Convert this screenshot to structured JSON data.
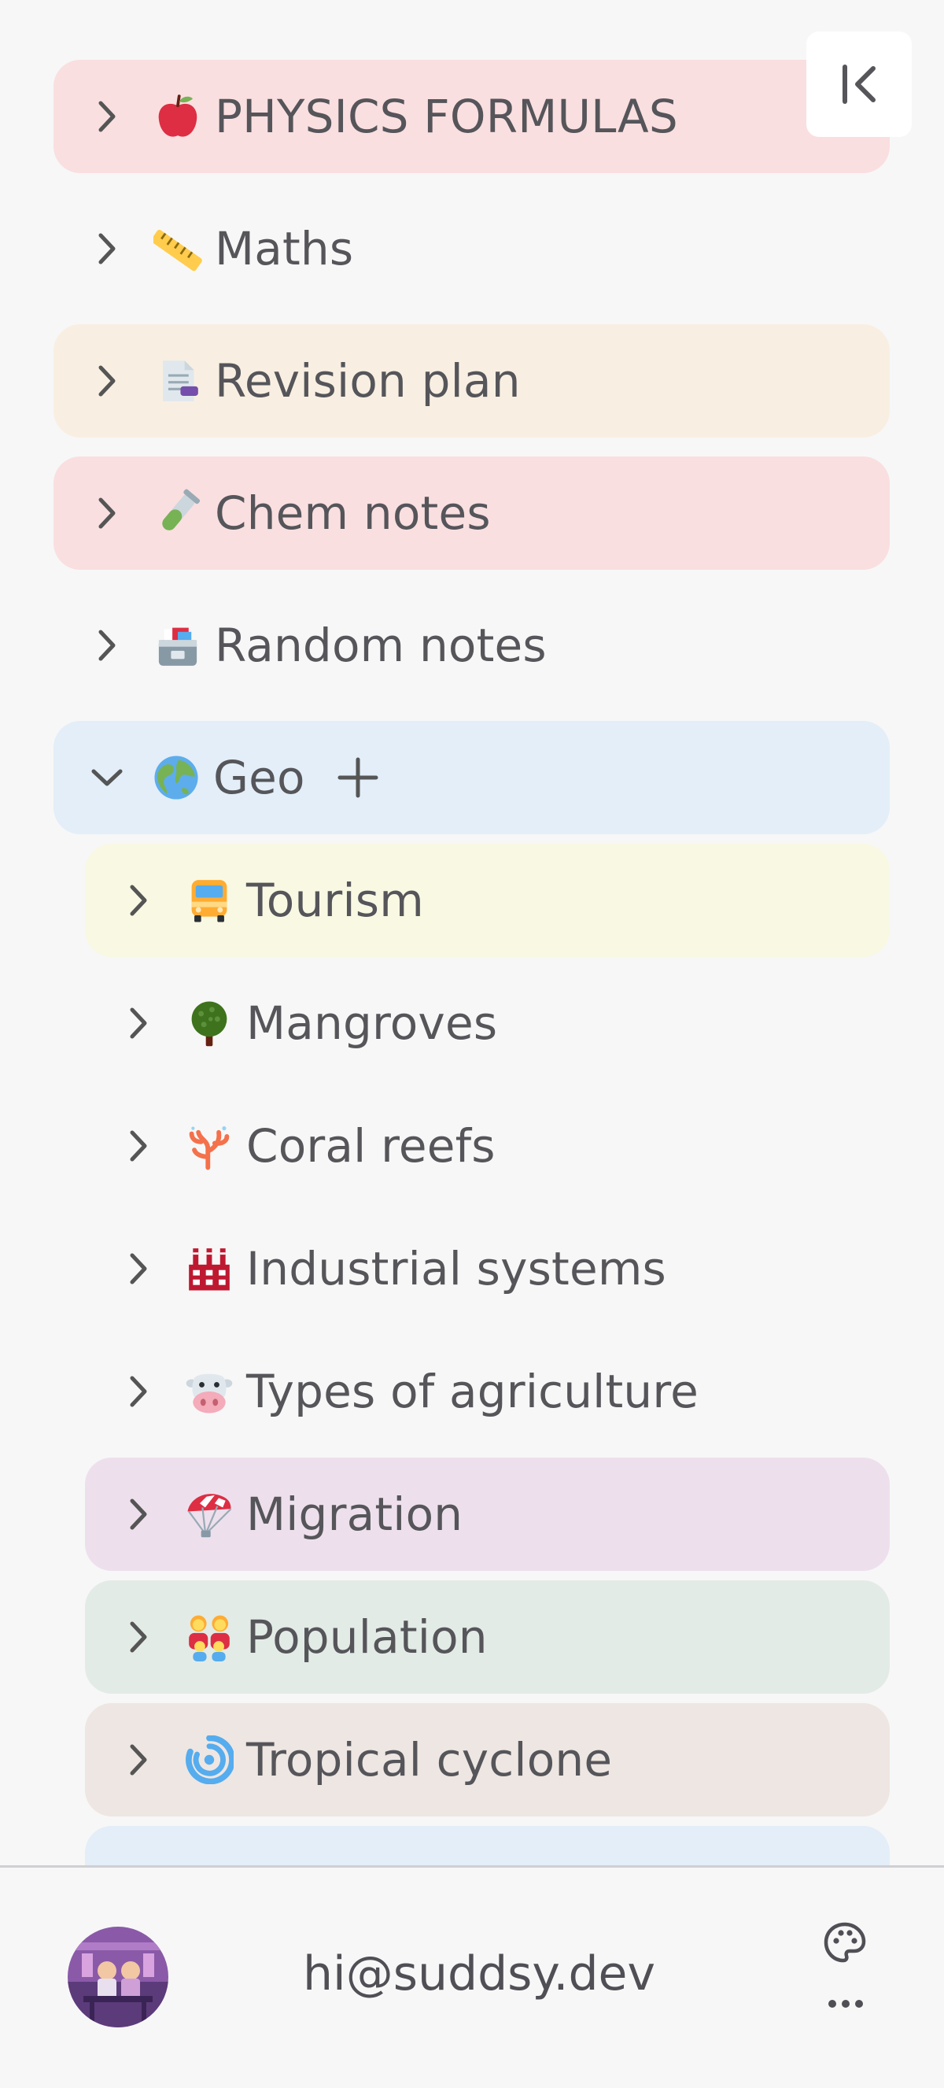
{
  "sidebar": {
    "items": [
      {
        "label": "PHYSICS FORMULAS",
        "icon": "red-apple-icon",
        "background": "#fadfe0"
      },
      {
        "label": "Maths",
        "icon": "ruler-icon",
        "background": "transparent"
      },
      {
        "label": "Revision plan",
        "icon": "document-icon",
        "background": "#f8efe2"
      },
      {
        "label": "Chem notes",
        "icon": "test-tube-icon",
        "background": "#fadfe0"
      },
      {
        "label": "Random notes",
        "icon": "card-file-box-icon",
        "background": "transparent"
      },
      {
        "label": "Geo",
        "icon": "globe-icon",
        "background": "#e3eef8",
        "expanded": true
      }
    ],
    "children": [
      {
        "label": "Tourism",
        "icon": "bus-icon",
        "background": "#f9f8e3"
      },
      {
        "label": "Mangroves",
        "icon": "tree-icon",
        "background": "transparent"
      },
      {
        "label": "Coral reefs",
        "icon": "coral-icon",
        "background": "transparent"
      },
      {
        "label": "Industrial systems",
        "icon": "factory-icon",
        "background": "transparent"
      },
      {
        "label": "Types of agriculture",
        "icon": "cow-icon",
        "background": "transparent"
      },
      {
        "label": "Migration",
        "icon": "parachute-icon",
        "background": "#ede0ec"
      },
      {
        "label": "Population",
        "icon": "family-icon",
        "background": "#e3ebe6"
      },
      {
        "label": "Tropical cyclone",
        "icon": "cyclone-icon",
        "background": "#eee6e2"
      }
    ],
    "collapse_icon": "collapse-sidebar-icon"
  },
  "footer": {
    "email": "hi@suddsy.dev",
    "palette_icon": "palette-icon",
    "more_icon": "more-icon"
  }
}
